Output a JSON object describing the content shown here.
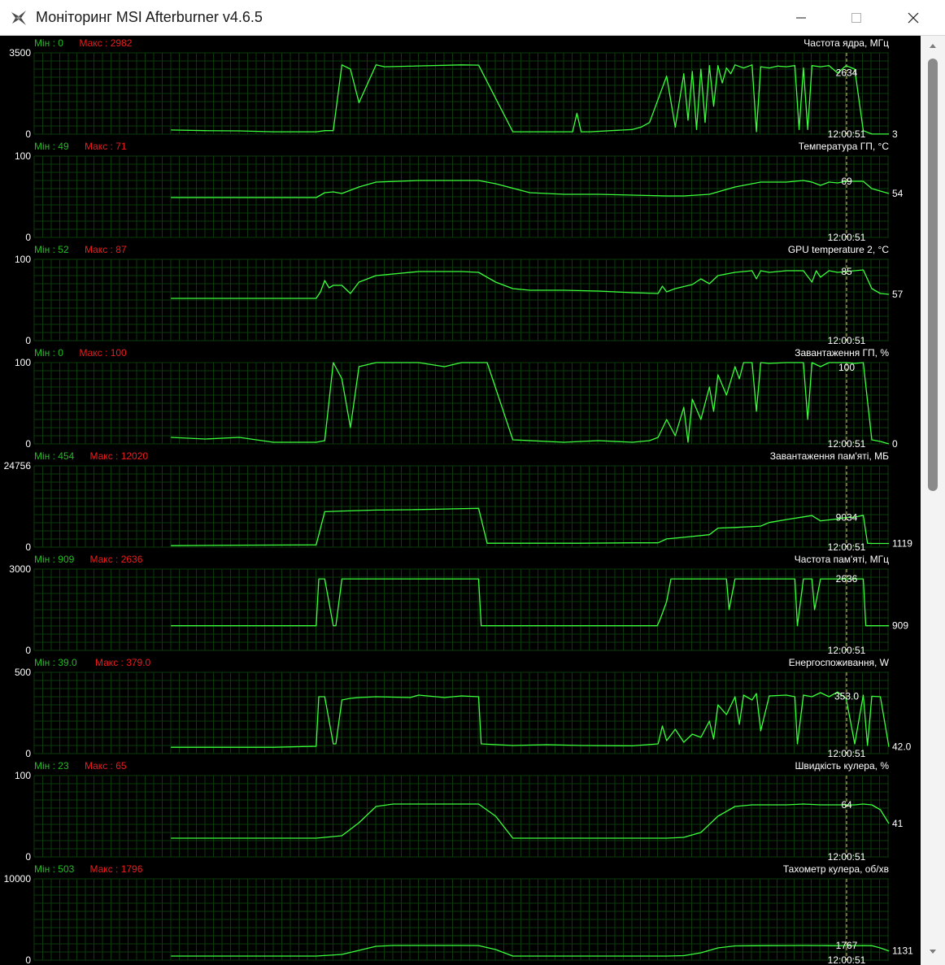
{
  "window": {
    "title": "Моніторинг MSI Afterburner v4.6.5",
    "icons": {
      "app": "afterburner-plane-icon",
      "minimize": "minimize-icon",
      "maximize": "maximize-icon",
      "close": "close-icon"
    }
  },
  "colors": {
    "background": "#000000",
    "grid": "#0b3a0b",
    "line": "#3cff3c",
    "min_label": "#22bb22",
    "max_label": "#ee1c1c",
    "text": "#ffffff",
    "cursor": "#d8d870"
  },
  "cursor_time": "12:00:51",
  "chart_data": [
    {
      "type": "line",
      "title": "Частота ядра, МГц",
      "min_label": "Мін : 0",
      "max_label": "Макс : 2982",
      "y_top_label": "3500",
      "y_bottom_label": "0",
      "ylim": [
        0,
        3500
      ],
      "cursor_value": "2634",
      "current_value": "3",
      "x": [
        16,
        20,
        24,
        28,
        33,
        34,
        35,
        36,
        37,
        38,
        40,
        41,
        50,
        52,
        56,
        62,
        63,
        63.5,
        64,
        65,
        70,
        71,
        72,
        74,
        75,
        76,
        76.5,
        77,
        77.5,
        78,
        78.5,
        79,
        79.5,
        80,
        80.5,
        81,
        81.5,
        82,
        83,
        84,
        84.5,
        85,
        86,
        87,
        88,
        89,
        89.5,
        90,
        90.5,
        91,
        92,
        93,
        94,
        95,
        96,
        97,
        98,
        99,
        100
      ],
      "y": [
        180,
        150,
        140,
        100,
        100,
        150,
        150,
        2982,
        2800,
        1350,
        2982,
        2900,
        2982,
        2970,
        100,
        100,
        100,
        900,
        100,
        100,
        200,
        300,
        500,
        2500,
        300,
        2600,
        600,
        2700,
        200,
        2800,
        500,
        2950,
        1200,
        2950,
        2200,
        2850,
        2600,
        2982,
        2850,
        2982,
        100,
        2900,
        2850,
        2930,
        2900,
        2950,
        200,
        2850,
        200,
        2950,
        2900,
        2950,
        2634,
        2950,
        2800,
        150,
        3,
        3,
        3
      ]
    },
    {
      "type": "line",
      "title": "Температура ГП, °C",
      "min_label": "Мін : 49",
      "max_label": "Макс : 71",
      "y_top_label": "100",
      "y_bottom_label": "0",
      "ylim": [
        0,
        100
      ],
      "cursor_value": "69",
      "current_value": "54",
      "x": [
        16,
        24,
        33,
        33.5,
        34,
        35,
        36,
        37,
        38,
        40,
        45,
        50,
        52,
        54,
        58,
        62,
        66,
        70,
        74,
        76,
        79,
        80,
        82,
        84,
        85,
        88,
        90,
        91,
        92,
        93,
        94,
        95,
        96,
        97,
        98,
        99,
        100
      ],
      "y": [
        49,
        49,
        49,
        52,
        55,
        56,
        54,
        58,
        62,
        68,
        70,
        70,
        70,
        66,
        55,
        53,
        53,
        52,
        51,
        51,
        53,
        56,
        62,
        66,
        68,
        68,
        70,
        68,
        64,
        68,
        67,
        69,
        69,
        69,
        60,
        57,
        54
      ]
    },
    {
      "type": "line",
      "title": "GPU temperature 2, °C",
      "min_label": "Мін : 52",
      "max_label": "Макс : 87",
      "y_top_label": "100",
      "y_bottom_label": "0",
      "ylim": [
        0,
        100
      ],
      "cursor_value": "85",
      "current_value": "57",
      "x": [
        16,
        24,
        33,
        33.5,
        34,
        34.5,
        35,
        36,
        37,
        38,
        40,
        45,
        50,
        52,
        54,
        56,
        58,
        62,
        66,
        70,
        73,
        73.5,
        74,
        75,
        77,
        78,
        79,
        80,
        82,
        84,
        84.5,
        85,
        86,
        88,
        90,
        91,
        91.5,
        92,
        93,
        94,
        95,
        96,
        97,
        98,
        99,
        100
      ],
      "y": [
        52,
        52,
        52,
        60,
        74,
        65,
        68,
        68,
        58,
        72,
        80,
        85,
        85,
        84,
        72,
        64,
        62,
        62,
        61,
        59,
        58,
        67,
        60,
        64,
        69,
        76,
        70,
        80,
        84,
        86,
        76,
        86,
        84,
        86,
        86,
        72,
        86,
        78,
        86,
        84,
        85,
        86,
        87,
        64,
        58,
        57
      ]
    },
    {
      "type": "line",
      "title": "Завантаження ГП, %",
      "min_label": "Мін : 0",
      "max_label": "Макс : 100",
      "y_top_label": "100",
      "y_bottom_label": "0",
      "ylim": [
        0,
        100
      ],
      "cursor_value": "100",
      "current_value": "0",
      "x": [
        16,
        20,
        24,
        28,
        30,
        33,
        34,
        35,
        36,
        37,
        38,
        40,
        42,
        44,
        45,
        48,
        50,
        52,
        53,
        56,
        62,
        66,
        70,
        72,
        73,
        74,
        75,
        76,
        76.5,
        77,
        78,
        79,
        79.5,
        80,
        81,
        82,
        82.5,
        83,
        84,
        84.5,
        85,
        86,
        88,
        89,
        90,
        90.5,
        91,
        92,
        93,
        94,
        95,
        96,
        97,
        98,
        99,
        100
      ],
      "y": [
        8,
        6,
        8,
        2,
        2,
        2,
        4,
        100,
        80,
        20,
        95,
        100,
        100,
        100,
        100,
        95,
        100,
        100,
        100,
        5,
        2,
        4,
        2,
        4,
        8,
        30,
        10,
        45,
        2,
        55,
        30,
        70,
        40,
        85,
        60,
        95,
        80,
        100,
        100,
        40,
        100,
        99,
        100,
        100,
        100,
        30,
        100,
        95,
        100,
        100,
        100,
        99,
        100,
        5,
        3,
        0
      ]
    },
    {
      "type": "line",
      "title": "Завантаження пам'яті, МБ",
      "min_label": "Мін : 454",
      "max_label": "Макс : 12020",
      "y_top_label": "24756",
      "y_bottom_label": "0",
      "ylim": [
        0,
        24756
      ],
      "cursor_value": "9034",
      "current_value": "1119",
      "x": [
        16,
        24,
        33,
        34,
        36,
        40,
        44,
        48,
        52,
        53,
        56,
        60,
        64,
        70,
        73,
        74,
        76,
        79,
        80,
        82,
        85,
        86,
        88,
        90,
        91,
        92,
        94,
        95,
        96,
        97,
        97.5,
        98,
        99,
        100
      ],
      "y": [
        454,
        600,
        700,
        10800,
        11000,
        11300,
        11400,
        11600,
        11800,
        1200,
        1200,
        1200,
        1200,
        1300,
        1300,
        2500,
        3000,
        3800,
        5800,
        6000,
        6400,
        7500,
        8400,
        9200,
        9600,
        8000,
        8600,
        9034,
        9100,
        9700,
        1200,
        1119,
        1119,
        1119
      ]
    },
    {
      "type": "line",
      "title": "Частота пам'яті, МГц",
      "min_label": "Мін : 909",
      "max_label": "Макс : 2636",
      "y_top_label": "3000",
      "y_bottom_label": "0",
      "ylim": [
        0,
        3000
      ],
      "cursor_value": "2636",
      "current_value": "909",
      "x": [
        16,
        20,
        24,
        28,
        33,
        33.3,
        34,
        35,
        35.3,
        36,
        37,
        38,
        40,
        45,
        50,
        52,
        52.3,
        56,
        62,
        66,
        70,
        72.9,
        73.3,
        74,
        74.5,
        80,
        81,
        81.3,
        82,
        88,
        89,
        89.3,
        90,
        91,
        91.3,
        92,
        93,
        95,
        97,
        97.3,
        98,
        100
      ],
      "y": [
        909,
        909,
        909,
        909,
        909,
        2636,
        2636,
        909,
        909,
        2636,
        2636,
        2636,
        2636,
        2636,
        2636,
        2636,
        909,
        909,
        909,
        909,
        909,
        909,
        1200,
        1800,
        2636,
        2636,
        2636,
        1500,
        2636,
        2636,
        2636,
        909,
        2636,
        2636,
        1500,
        2636,
        2636,
        2636,
        2636,
        909,
        909,
        909
      ]
    },
    {
      "type": "line",
      "title": "Енергоспоживання, W",
      "min_label": "Мін : 39.0",
      "max_label": "Макс : 379.0",
      "y_top_label": "500",
      "y_bottom_label": "0",
      "ylim": [
        0,
        500
      ],
      "cursor_value": "353.0",
      "current_value": "42.0",
      "x": [
        16,
        20,
        24,
        28,
        33,
        33.3,
        34,
        35,
        35.3,
        36,
        37,
        38,
        40,
        44,
        45,
        48,
        50,
        52,
        52.3,
        56,
        60,
        64,
        70,
        73,
        73.5,
        74,
        75,
        76,
        77,
        78,
        79,
        79.5,
        80,
        81,
        82,
        82.5,
        83,
        84,
        84.5,
        85,
        86,
        88,
        89,
        89.3,
        90,
        91,
        92,
        93,
        94,
        95,
        96,
        97,
        97.5,
        98,
        99,
        100
      ],
      "y": [
        39,
        39,
        39,
        39,
        45,
        350,
        350,
        60,
        60,
        330,
        340,
        345,
        350,
        345,
        360,
        345,
        355,
        350,
        60,
        50,
        55,
        50,
        48,
        60,
        170,
        80,
        150,
        70,
        120,
        100,
        200,
        90,
        300,
        240,
        350,
        180,
        360,
        330,
        370,
        140,
        355,
        360,
        350,
        60,
        360,
        350,
        375,
        350,
        379,
        340,
        60,
        360,
        50,
        353,
        350,
        42
      ]
    },
    {
      "type": "line",
      "title": "Швидкість кулера, %",
      "min_label": "Мін : 23",
      "max_label": "Макс : 65",
      "y_top_label": "100",
      "y_bottom_label": "0",
      "ylim": [
        0,
        100
      ],
      "cursor_value": "64",
      "current_value": "41",
      "x": [
        16,
        24,
        33,
        36,
        38,
        40,
        42,
        45,
        50,
        52,
        54,
        56,
        60,
        66,
        70,
        74,
        76,
        78,
        80,
        82,
        84,
        86,
        88,
        90,
        92,
        94,
        95,
        96,
        97,
        98,
        99,
        100
      ],
      "y": [
        23,
        23,
        23,
        26,
        42,
        62,
        65,
        65,
        65,
        65,
        50,
        23,
        23,
        23,
        23,
        23,
        24,
        30,
        50,
        62,
        64,
        64,
        64,
        65,
        64,
        64,
        64,
        64,
        65,
        64,
        58,
        41
      ]
    },
    {
      "type": "line",
      "title": "Тахометр кулера, об/хв",
      "min_label": "Мін : 503",
      "max_label": "Макс : 1796",
      "y_top_label": "10000",
      "y_bottom_label": "0",
      "ylim": [
        0,
        10000
      ],
      "cursor_value": "1767",
      "current_value": "1131",
      "x": [
        16,
        24,
        33,
        36,
        38,
        40,
        42,
        45,
        50,
        52,
        54,
        56,
        60,
        66,
        70,
        74,
        76,
        78,
        80,
        82,
        84,
        86,
        88,
        90,
        92,
        94,
        95,
        96,
        97,
        98,
        99,
        100
      ],
      "y": [
        503,
        503,
        503,
        700,
        1200,
        1700,
        1796,
        1796,
        1796,
        1790,
        1300,
        503,
        503,
        503,
        503,
        503,
        550,
        900,
        1500,
        1750,
        1767,
        1780,
        1790,
        1796,
        1790,
        1767,
        1767,
        1767,
        1790,
        1767,
        1500,
        1131
      ]
    }
  ]
}
